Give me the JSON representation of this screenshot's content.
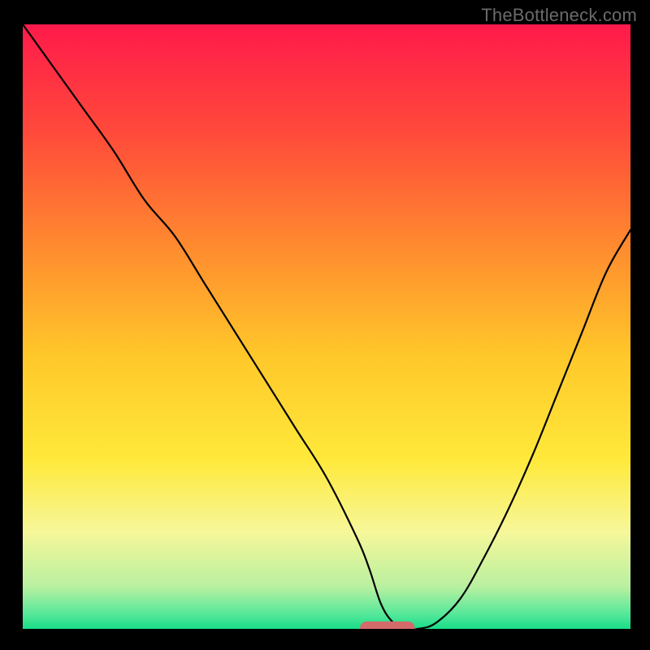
{
  "watermark": "TheBottleneck.com",
  "chart_data": {
    "type": "line",
    "title": "",
    "xlabel": "",
    "ylabel": "",
    "xlim": [
      0,
      100
    ],
    "ylim": [
      0,
      100
    ],
    "grid": false,
    "legend": false,
    "background_gradient_stops": [
      {
        "offset": 0.0,
        "color": "#ff1a4b"
      },
      {
        "offset": 0.18,
        "color": "#ff4a3a"
      },
      {
        "offset": 0.38,
        "color": "#ff8f2e"
      },
      {
        "offset": 0.55,
        "color": "#ffc82a"
      },
      {
        "offset": 0.72,
        "color": "#ffe93a"
      },
      {
        "offset": 0.84,
        "color": "#f6f79a"
      },
      {
        "offset": 0.93,
        "color": "#b9f0a0"
      },
      {
        "offset": 0.975,
        "color": "#57e89a"
      },
      {
        "offset": 1.0,
        "color": "#18dd88"
      }
    ],
    "series": [
      {
        "name": "bottleneck-curve",
        "color": "#000000",
        "stroke_width": 2.2,
        "x": [
          0,
          5,
          10,
          15,
          20,
          25,
          30,
          35,
          40,
          45,
          50,
          55,
          57,
          59,
          61,
          63,
          65,
          68,
          72,
          76,
          80,
          84,
          88,
          92,
          96,
          100
        ],
        "y": [
          100,
          93,
          86,
          79,
          71,
          65,
          57,
          49,
          41,
          33,
          25,
          15,
          10,
          4,
          1,
          0,
          0,
          1,
          5,
          12,
          20,
          29,
          39,
          49,
          59,
          66
        ]
      }
    ],
    "marker": {
      "name": "optimal-marker",
      "shape": "rounded-rect",
      "color": "#d46a6a",
      "x": 60,
      "y": 0,
      "width": 9,
      "height": 2.2
    }
  }
}
